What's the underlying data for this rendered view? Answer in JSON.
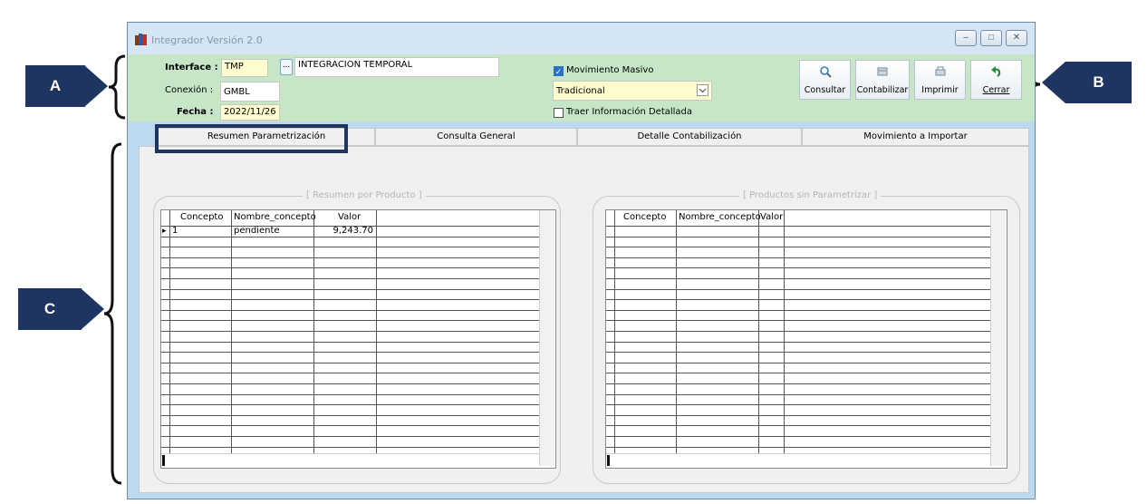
{
  "window": {
    "title": "Integrador Versión 2.0",
    "controls": [
      "–",
      "□",
      "✕"
    ]
  },
  "header": {
    "interface_label": "Interface :",
    "interface_value": "TMP",
    "browse_label": "...",
    "interface_name": "INTEGRACION TEMPORAL",
    "conexion_label": "Conexión :",
    "conexion_value": "GMBL",
    "fecha_label": "Fecha :",
    "fecha_value": "2022/11/26",
    "movimiento_masivo_label": "Movimiento Masivo",
    "movimiento_masivo_checked": true,
    "tipo_value": "Tradicional",
    "traer_info_label": "Traer Información Detallada",
    "traer_info_checked": false
  },
  "toolbar": {
    "consultar": {
      "label": "Consultar",
      "icon": "magnifier-icon"
    },
    "contabilizar": {
      "label": "Contabilizar",
      "icon": "ledger-icon"
    },
    "imprimir": {
      "label": "Imprimir",
      "icon": "printer-icon"
    },
    "cerrar": {
      "label": "Cerrar",
      "icon": "undo-arrow-icon"
    }
  },
  "tabs": [
    "Resumen Parametrización",
    "Consulta General",
    "Detalle Contabilización",
    "Movimiento a Importar"
  ],
  "left_group": {
    "title": "[ Resumen por Producto ]",
    "columns": [
      "Concepto",
      "Nombre_concepto",
      "Valor"
    ],
    "rows": [
      [
        "1",
        "pendiente",
        "9,243.70"
      ]
    ]
  },
  "right_group": {
    "title": "[ Productos sin Parametrizar ]",
    "columns": [
      "Concepto",
      "Nombre_concepto",
      "Valor"
    ],
    "rows": []
  },
  "annotations": {
    "a": "A",
    "b": "B",
    "c": "C"
  },
  "colors": {
    "annotation": "#1e3461",
    "header_band": "#c6e6c7",
    "input_bg": "#fffdd0"
  }
}
